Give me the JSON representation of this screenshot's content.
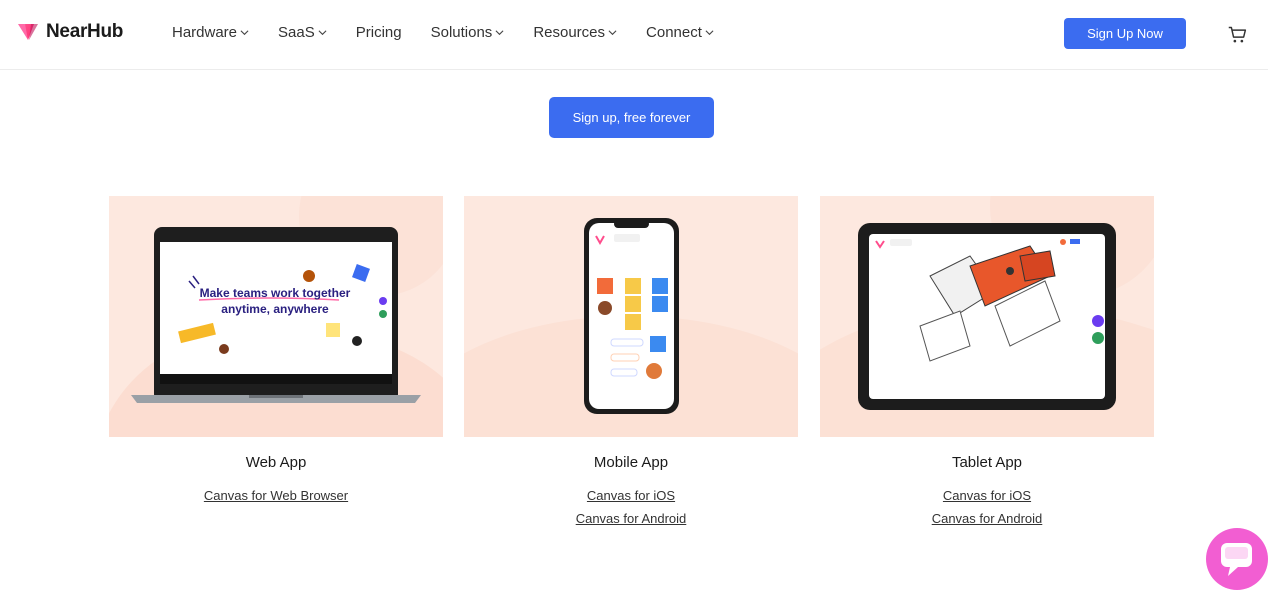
{
  "header": {
    "brand": "NearHub",
    "nav": [
      {
        "label": "Hardware",
        "dropdown": true
      },
      {
        "label": "SaaS",
        "dropdown": true
      },
      {
        "label": "Pricing",
        "dropdown": false
      },
      {
        "label": "Solutions",
        "dropdown": true
      },
      {
        "label": "Resources",
        "dropdown": true
      },
      {
        "label": "Connect",
        "dropdown": true
      }
    ],
    "signup_label": "Sign Up Now",
    "cart_icon": "cart-icon"
  },
  "cta": {
    "label": "Sign up, free forever"
  },
  "cards": [
    {
      "title": "Web App",
      "links": [
        "Canvas for Web Browser"
      ],
      "screen_headline_1": "Make teams work together",
      "screen_headline_2": "anytime, anywhere"
    },
    {
      "title": "Mobile App",
      "links": [
        "Canvas for iOS",
        "Canvas for Android"
      ]
    },
    {
      "title": "Tablet App",
      "links": [
        "Canvas for iOS",
        "Canvas for Android"
      ]
    }
  ],
  "colors": {
    "accent": "#3b6cf0",
    "card_bg": "#fde8df",
    "chat": "#f25ed2"
  }
}
